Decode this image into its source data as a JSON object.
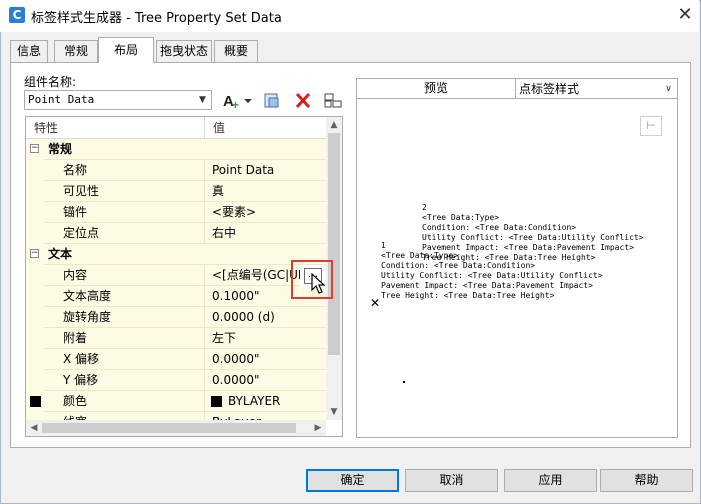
{
  "window": {
    "title": "标签样式生成器 - Tree Property Set Data",
    "app_icon": "C"
  },
  "tabs": [
    {
      "label": "信息",
      "active": false
    },
    {
      "label": "常规",
      "active": false
    },
    {
      "label": "布局",
      "active": true
    },
    {
      "label": "拖曳状态",
      "active": false
    },
    {
      "label": "概要",
      "active": false
    }
  ],
  "component": {
    "label": "组件名称:",
    "value": "Point Data"
  },
  "toolbar": {
    "add_icon": "add-component-icon",
    "copy_icon": "copy-component-icon",
    "delete_icon": "delete-icon",
    "order_icon": "draw-order-icon"
  },
  "grid": {
    "headers": [
      "特性",
      "值"
    ],
    "rows": [
      {
        "type": "category",
        "label": "常规"
      },
      {
        "type": "prop",
        "name": "名称",
        "value": "Point Data"
      },
      {
        "type": "prop",
        "name": "可见性",
        "value": "真"
      },
      {
        "type": "prop",
        "name": "锚件",
        "value": "<要素>"
      },
      {
        "type": "prop",
        "name": "定位点",
        "value": "右中"
      },
      {
        "type": "category",
        "label": "文本"
      },
      {
        "type": "prop",
        "name": "内容",
        "value": "<[点编号(GC|UN"
      },
      {
        "type": "prop",
        "name": "文本高度",
        "value": "0.1000\""
      },
      {
        "type": "prop",
        "name": "旋转角度",
        "value": "0.0000 (d)"
      },
      {
        "type": "prop",
        "name": "附着",
        "value": "左下"
      },
      {
        "type": "prop",
        "name": "X 偏移",
        "value": "0.0000\""
      },
      {
        "type": "prop",
        "name": "Y 偏移",
        "value": "0.0000\""
      },
      {
        "type": "prop",
        "name": "颜色",
        "value": "BYLAYER"
      },
      {
        "type": "prop",
        "name": "线宽",
        "value": "ByLayer"
      }
    ],
    "ellipsis": "..."
  },
  "preview": {
    "label": "预览",
    "style_select": "点标签样式",
    "block_a": "2\n<Tree Data:Type>\nCondition: <Tree Data:Condition>\nUtility Conflict: <Tree Data:Utility Conflict>\nPavement Impact: <Tree Data:Pavement Impact>\nTree Height: <Tree Data:Tree Height>",
    "block_b": "1\n<Tree Data:Type>\nCondition: <Tree Data:Condition>\nUtility Conflict: <Tree Data:Utility Conflict>\nPavement Impact: <Tree Data:Pavement Impact>\nTree Height: <Tree Data:Tree Height>"
  },
  "buttons": {
    "ok": "确定",
    "cancel": "取消",
    "apply": "应用",
    "help": "帮助"
  },
  "colors": {
    "accent": "#0078d7",
    "highlight": "#e03c31",
    "grid_bg": "#fdfbe3"
  }
}
